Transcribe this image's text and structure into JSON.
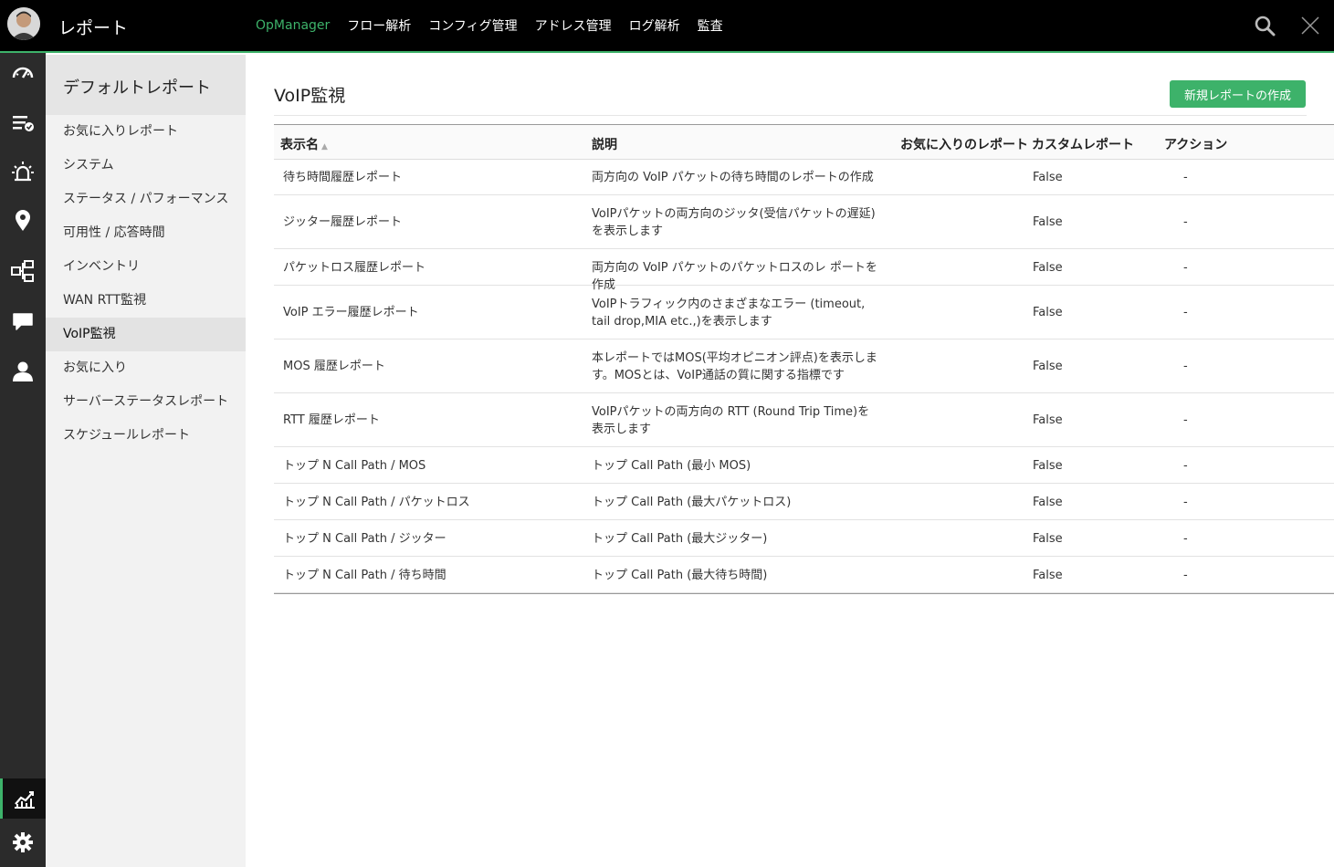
{
  "app": {
    "title": "レポート"
  },
  "topnav": [
    {
      "label": "OpManager",
      "active": true
    },
    {
      "label": "フロー解析",
      "active": false
    },
    {
      "label": "コンフィグ管理",
      "active": false
    },
    {
      "label": "アドレス管理",
      "active": false
    },
    {
      "label": "ログ解析",
      "active": false
    },
    {
      "label": "監査",
      "active": false
    }
  ],
  "rail": [
    "dashboard-icon",
    "inventory-icon",
    "alarm-icon",
    "map-icon",
    "workflow-icon",
    "chat-icon",
    "user-icon",
    "reports-icon",
    "settings-icon"
  ],
  "subnav": {
    "title": "デフォルトレポート",
    "items": [
      "お気に入りレポート",
      "システム",
      "ステータス / パフォーマンス",
      "可用性 / 応答時間",
      "インベントリ",
      "WAN RTT監視",
      "VoIP監視",
      "お気に入り",
      "サーバーステータスレポート",
      "スケジュールレポート"
    ],
    "active_index": 6
  },
  "page": {
    "title": "VoIP監視",
    "create_button": "新規レポートの作成"
  },
  "table": {
    "headers": {
      "name": "表示名",
      "desc": "説明",
      "fav": "お気に入りのレポート",
      "custom": "カスタムレポート",
      "action": "アクション"
    },
    "rows": [
      {
        "name": "待ち時間履歴レポート",
        "desc": "両方向の VoIP パケットの待ち時間のレポートの作成",
        "fav": "",
        "custom": "False",
        "action": "-"
      },
      {
        "name": "ジッター履歴レポート",
        "desc": "VoIPパケットの両方向のジッタ(受信パケットの遅延)を表示します",
        "fav": "",
        "custom": "False",
        "action": "-"
      },
      {
        "name": "パケットロス履歴レポート",
        "desc": "両方向の VoIP パケットのパケットロスのレ ポートを作成",
        "fav": "",
        "custom": "False",
        "action": "-"
      },
      {
        "name": "VoIP エラー履歴レポート",
        "desc": "VoIPトラフィック内のさまざまなエラー (timeout, tail drop,MIA etc.,)を表示します",
        "fav": "",
        "custom": "False",
        "action": "-"
      },
      {
        "name": "MOS 履歴レポート",
        "desc": "本レポートではMOS(平均オピニオン評点)を表示します。MOSとは、VoIP通話の質に関する指標です",
        "fav": "",
        "custom": "False",
        "action": "-"
      },
      {
        "name": "RTT 履歴レポート",
        "desc": "VoIPパケットの両方向の RTT (Round Trip Time)を表示します",
        "fav": "",
        "custom": "False",
        "action": "-"
      },
      {
        "name": "トップ N Call Path / MOS",
        "desc": "トップ Call Path (最小 MOS)",
        "fav": "",
        "custom": "False",
        "action": "-"
      },
      {
        "name": "トップ N Call Path / パケットロス",
        "desc": "トップ Call Path (最大パケットロス)",
        "fav": "",
        "custom": "False",
        "action": "-"
      },
      {
        "name": "トップ N Call Path / ジッター",
        "desc": "トップ Call Path (最大ジッター)",
        "fav": "",
        "custom": "False",
        "action": "-"
      },
      {
        "name": "トップ N Call Path / 待ち時間",
        "desc": "トップ Call Path (最大待ち時間)",
        "fav": "",
        "custom": "False",
        "action": "-"
      }
    ]
  },
  "colors": {
    "accent": "#3db26a",
    "topbar": "#000000",
    "rail": "#2b2b2b"
  }
}
